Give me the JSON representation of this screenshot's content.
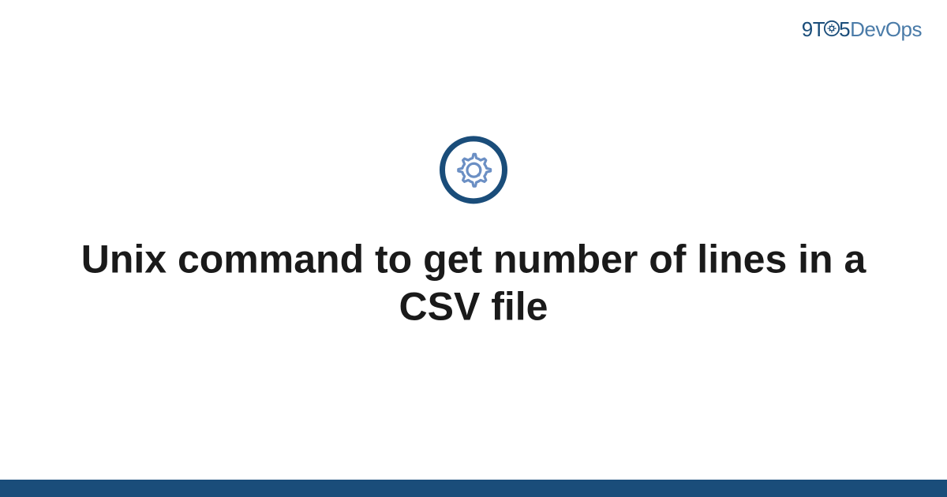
{
  "brand": {
    "part1": "9T",
    "part2": "5",
    "part3": "DevOps"
  },
  "page": {
    "title": "Unix command to get number of lines in a CSV file"
  },
  "colors": {
    "brand_dark": "#1a4d7a",
    "brand_light": "#4a7ba8",
    "gear_icon": "#6b8fc4"
  }
}
